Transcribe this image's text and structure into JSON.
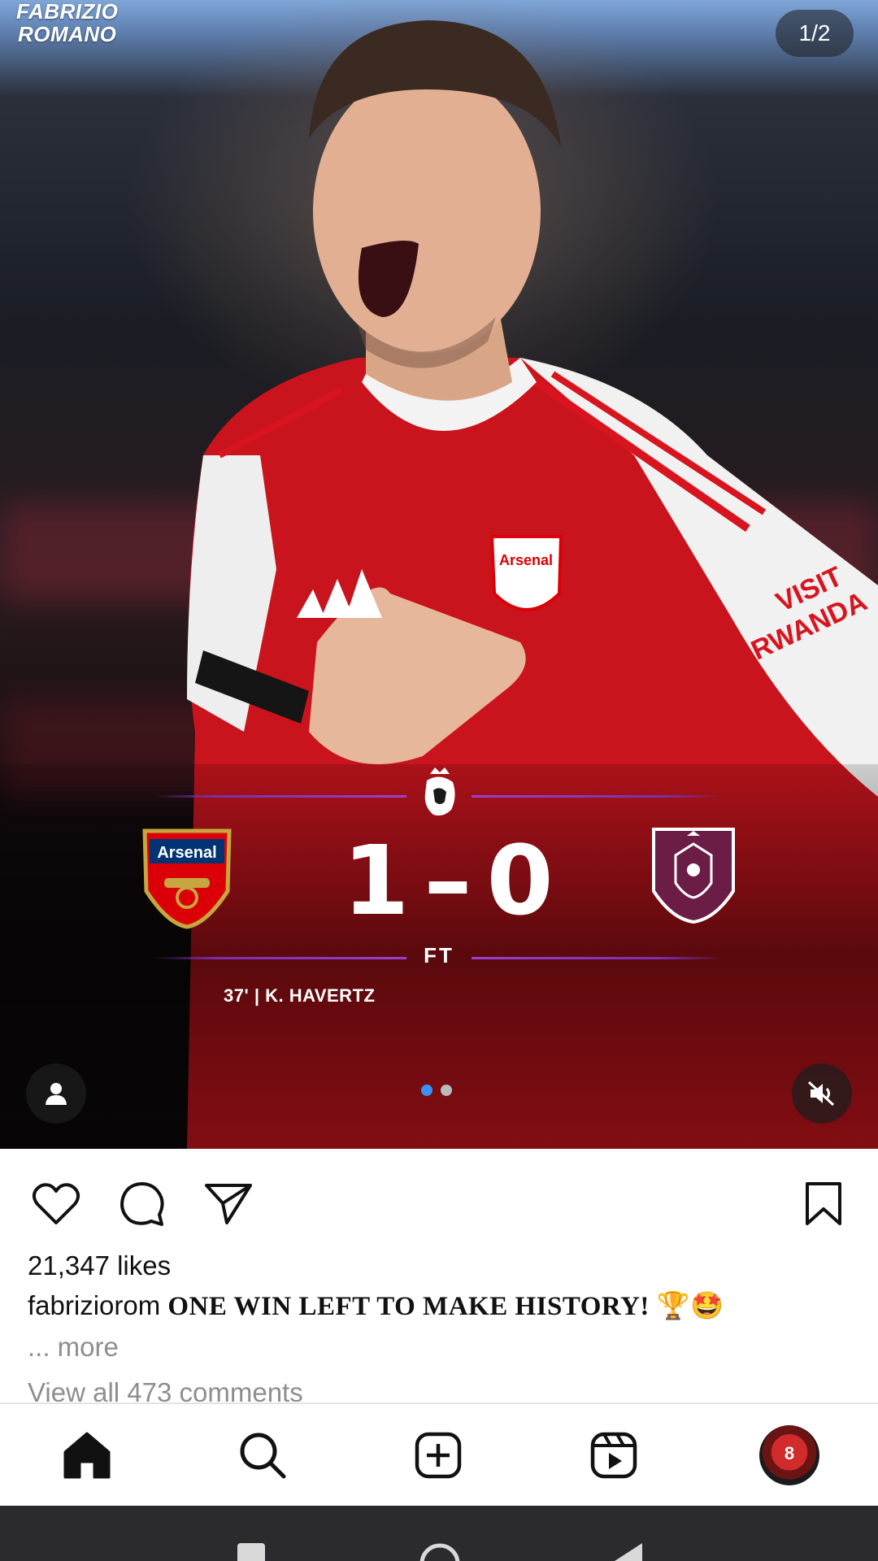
{
  "media": {
    "watermark_line1": "FABRIZIO",
    "watermark_line2": "ROMANO",
    "counter": "1/2",
    "score_home": "1",
    "score_sep": "–",
    "score_away": "0",
    "status": "FT",
    "scorer": "37' | K. HAVERTZ",
    "home_crest_text": "Arsenal",
    "shirt_text": "Arsenal",
    "sleeve_sponsor_1": "VISIT",
    "sleeve_sponsor_2": "RWANDA",
    "carousel_dots": 2,
    "active_dot": 0
  },
  "post": {
    "likes": "21,347 likes",
    "username": "fabriziorom",
    "caption": "ONE WIN LEFT TO MAKE HISTORY! 🏆🤩",
    "more": "... more",
    "comments": "View all 473 comments"
  },
  "nav": {
    "items": [
      "home-icon",
      "search-icon",
      "create-icon",
      "reels-icon",
      "profile-avatar"
    ],
    "avatar_number": "8"
  },
  "colors": {
    "pl_purple": "#7a2fb0",
    "arsenal_red": "#db0007",
    "burnley_claret": "#6c1d45",
    "dot_active": "#3b93f7"
  }
}
